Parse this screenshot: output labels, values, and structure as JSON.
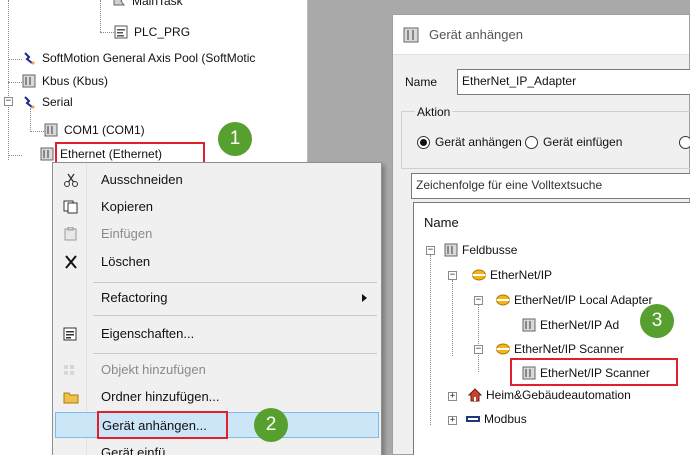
{
  "tree": {
    "items": [
      {
        "label": "MainTask"
      },
      {
        "label": "PLC_PRG"
      },
      {
        "label": "SoftMotion General Axis Pool (SoftMotic"
      },
      {
        "label": "Kbus (Kbus)"
      },
      {
        "label": "Serial"
      },
      {
        "label": "COM1 (COM1)"
      },
      {
        "label": "Ethernet (Ethernet)"
      }
    ]
  },
  "context_menu": {
    "items": [
      {
        "label": "Ausschneiden",
        "icon": "scissors-icon"
      },
      {
        "label": "Kopieren",
        "icon": "copy-icon"
      },
      {
        "label": "Einfügen",
        "icon": "paste-icon"
      },
      {
        "label": "Löschen",
        "icon": "delete-x-icon"
      },
      {
        "label": "Refactoring",
        "icon": "submenu-arrow-icon"
      },
      {
        "label": "Eigenschaften...",
        "icon": "properties-icon"
      },
      {
        "label": "Objekt hinzufügen",
        "icon": "add-object-icon"
      },
      {
        "label": "Ordner hinzufügen...",
        "icon": "folder-icon"
      },
      {
        "label": "Gerät anhängen...",
        "icon": ""
      },
      {
        "label": "Gerät einfü",
        "icon": ""
      }
    ]
  },
  "dialog": {
    "title": "Gerät anhängen",
    "name_label": "Name",
    "name_value": "EtherNet_IP_Adapter",
    "action_label": "Aktion",
    "radio_attach": "Gerät anhängen",
    "radio_insert": "Gerät einfügen",
    "search_placeholder": "Zeichenfolge für eine Volltextsuche",
    "column_header": "Name",
    "devices": [
      {
        "label": "Feldbusse"
      },
      {
        "label": "EtherNet/IP"
      },
      {
        "label": "EtherNet/IP Local Adapter"
      },
      {
        "label": "EtherNet/IP Ad"
      },
      {
        "label": "EtherNet/IP Scanner"
      },
      {
        "label": "EtherNet/IP Scanner"
      },
      {
        "label": "Heim&Gebäudeautomation"
      },
      {
        "label": "Modbus"
      }
    ]
  },
  "badges": [
    "1",
    "2",
    "3"
  ],
  "colors": {
    "highlight_red": "#e0212b",
    "badge_green": "#57a02f",
    "menu_highlight": "#cde6f7",
    "ethernet_ip_yellow": "#f2b51c"
  }
}
